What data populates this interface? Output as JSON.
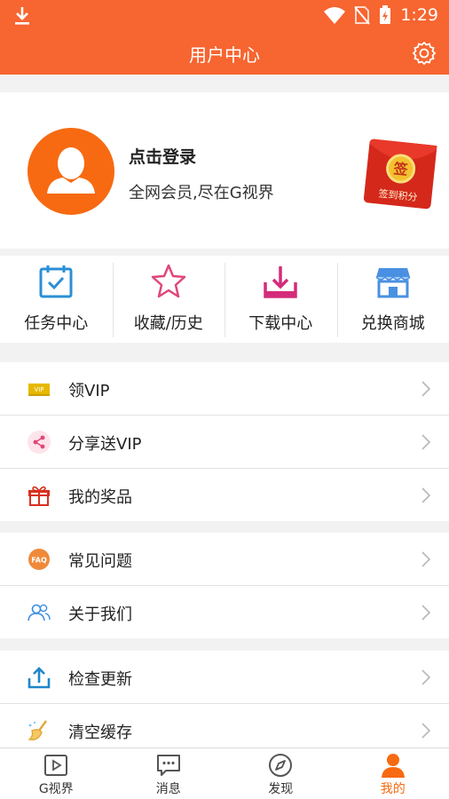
{
  "status_bar": {
    "time": "1:29"
  },
  "header": {
    "title": "用户中心"
  },
  "profile": {
    "login_label": "点击登录",
    "slogan": "全网会员,尽在G视界",
    "red_packet": {
      "center_text": "签",
      "label": "签到积分"
    }
  },
  "quick_actions": [
    {
      "label": "任务中心",
      "icon": "task-calendar-icon"
    },
    {
      "label": "收藏/历史",
      "icon": "star-icon"
    },
    {
      "label": "下载中心",
      "icon": "download-tray-icon"
    },
    {
      "label": "兑换商城",
      "icon": "store-icon"
    }
  ],
  "menu_groups": [
    [
      {
        "label": "领VIP",
        "icon": "vip-ticket-icon",
        "badge": "VIP"
      },
      {
        "label": "分享送VIP",
        "icon": "share-icon"
      },
      {
        "label": "我的奖品",
        "icon": "gift-icon"
      }
    ],
    [
      {
        "label": "常见问题",
        "icon": "faq-icon",
        "badge": "FAQ"
      },
      {
        "label": "关于我们",
        "icon": "people-icon"
      }
    ],
    [
      {
        "label": "检查更新",
        "icon": "upload-icon"
      },
      {
        "label": "清空缓存",
        "icon": "broom-icon"
      }
    ]
  ],
  "bottom_nav": [
    {
      "label": "G视界",
      "icon": "video-play-icon",
      "active": false
    },
    {
      "label": "消息",
      "icon": "chat-bubble-icon",
      "active": false
    },
    {
      "label": "发现",
      "icon": "compass-icon",
      "active": false
    },
    {
      "label": "我的",
      "icon": "person-icon",
      "active": true
    }
  ],
  "colors": {
    "primary": "#f76530",
    "accent": "#f76a12",
    "blue": "#2b8fd6",
    "pink": "#e0467b",
    "red": "#d9301f",
    "gold": "#f0b400"
  }
}
